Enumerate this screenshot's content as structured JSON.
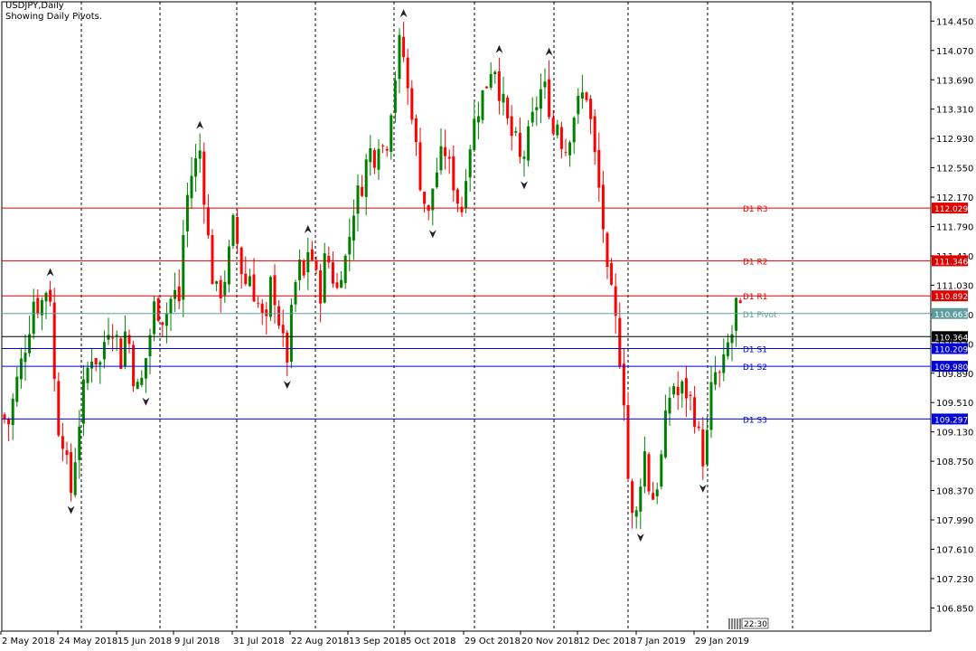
{
  "header": {
    "symbol_line": "USDJPY,Daily",
    "indicator_line": "Showing Daily Pivots."
  },
  "clock": "22:30",
  "colors": {
    "bull": "#008000",
    "bear": "#ff0000",
    "resistance": "#e00000",
    "support": "#0000dd",
    "pivot": "#5f9ea0",
    "current": "#000000"
  },
  "chart_data": {
    "type": "candlestick",
    "symbol": "USDJPY",
    "timeframe": "Daily",
    "ylim": [
      106.55,
      114.7
    ],
    "y_ticks": [
      "114.450",
      "114.070",
      "113.690",
      "113.310",
      "112.930",
      "112.550",
      "112.170",
      "111.790",
      "111.410",
      "111.030",
      "110.650",
      "110.270",
      "109.890",
      "109.510",
      "109.130",
      "108.750",
      "108.370",
      "107.990",
      "107.610",
      "107.230",
      "106.850"
    ],
    "x_labels": [
      "2 May 2018",
      "24 May 2018",
      "15 Jun 2018",
      "9 Jul 2018",
      "31 Jul 2018",
      "22 Aug 2018",
      "13 Sep 2018",
      "5 Oct 2018",
      "29 Oct 2018",
      "20 Nov 2018",
      "12 Dec 2018",
      "7 Jan 2019",
      "29 Jan 2019"
    ],
    "pivot_levels": [
      {
        "name": "D1 R3",
        "value": "112.029",
        "kind": "resistance"
      },
      {
        "name": "D1 R2",
        "value": "111.346",
        "kind": "resistance"
      },
      {
        "name": "D1 R1",
        "value": "110.892",
        "kind": "resistance"
      },
      {
        "name": "D1 Pivot",
        "value": "110.663",
        "kind": "pivot"
      },
      {
        "name": "D1 S1",
        "value": "110.209",
        "kind": "support"
      },
      {
        "name": "D1 S2",
        "value": "109.980",
        "kind": "support"
      },
      {
        "name": "D1 S3",
        "value": "109.297",
        "kind": "support"
      }
    ],
    "current_price": "110.364",
    "close_path": [
      [
        0,
        109.55
      ],
      [
        8,
        109.15
      ],
      [
        17,
        109.7
      ],
      [
        25,
        110.1
      ],
      [
        33,
        110.55
      ],
      [
        38,
        110.9
      ],
      [
        44,
        110.7
      ],
      [
        50,
        111.0
      ],
      [
        56,
        110.9
      ],
      [
        62,
        109.3
      ],
      [
        70,
        109.05
      ],
      [
        78,
        108.3
      ],
      [
        83,
        108.8
      ],
      [
        90,
        109.5
      ],
      [
        96,
        109.9
      ],
      [
        103,
        110.2
      ],
      [
        110,
        109.95
      ],
      [
        116,
        110.35
      ],
      [
        122,
        110.6
      ],
      [
        128,
        110.4
      ],
      [
        134,
        110.05
      ],
      [
        140,
        110.55
      ],
      [
        147,
        109.9
      ],
      [
        154,
        109.6
      ],
      [
        160,
        110.0
      ],
      [
        166,
        110.4
      ],
      [
        172,
        110.85
      ],
      [
        178,
        110.6
      ],
      [
        185,
        110.7
      ],
      [
        192,
        110.95
      ],
      [
        198,
        110.8
      ],
      [
        204,
        111.9
      ],
      [
        210,
        112.4
      ],
      [
        216,
        112.6
      ],
      [
        222,
        112.8
      ],
      [
        228,
        111.9
      ],
      [
        234,
        111.2
      ],
      [
        240,
        110.9
      ],
      [
        246,
        111.0
      ],
      [
        252,
        111.3
      ],
      [
        258,
        111.8
      ],
      [
        264,
        111.5
      ],
      [
        270,
        111.0
      ],
      [
        276,
        111.2
      ],
      [
        282,
        110.9
      ],
      [
        288,
        110.7
      ],
      [
        294,
        110.4
      ],
      [
        300,
        111.1
      ],
      [
        306,
        110.8
      ],
      [
        312,
        110.3
      ],
      [
        318,
        110.1
      ],
      [
        324,
        110.8
      ],
      [
        330,
        111.3
      ],
      [
        336,
        111.1
      ],
      [
        342,
        111.6
      ],
      [
        348,
        111.2
      ],
      [
        354,
        110.9
      ],
      [
        360,
        111.4
      ],
      [
        366,
        111.3
      ],
      [
        372,
        110.9
      ],
      [
        378,
        111.3
      ],
      [
        384,
        111.4
      ],
      [
        390,
        112.0
      ],
      [
        396,
        112.2
      ],
      [
        402,
        112.4
      ],
      [
        408,
        112.8
      ],
      [
        414,
        112.7
      ],
      [
        420,
        113.0
      ],
      [
        426,
        112.7
      ],
      [
        432,
        113.3
      ],
      [
        438,
        113.8
      ],
      [
        444,
        114.3
      ],
      [
        450,
        113.6
      ],
      [
        456,
        113.3
      ],
      [
        462,
        112.6
      ],
      [
        468,
        112.2
      ],
      [
        474,
        111.9
      ],
      [
        480,
        112.4
      ],
      [
        486,
        112.6
      ],
      [
        492,
        112.8
      ],
      [
        498,
        112.5
      ],
      [
        504,
        112.3
      ],
      [
        510,
        111.9
      ],
      [
        516,
        112.6
      ],
      [
        522,
        113.0
      ],
      [
        528,
        113.3
      ],
      [
        534,
        113.5
      ],
      [
        540,
        113.7
      ],
      [
        546,
        114.0
      ],
      [
        552,
        113.6
      ],
      [
        558,
        113.3
      ],
      [
        564,
        113.0
      ],
      [
        570,
        112.9
      ],
      [
        576,
        112.6
      ],
      [
        582,
        112.8
      ],
      [
        588,
        113.1
      ],
      [
        594,
        113.4
      ],
      [
        600,
        113.6
      ],
      [
        606,
        113.5
      ],
      [
        612,
        113.0
      ],
      [
        618,
        113.2
      ],
      [
        624,
        112.7
      ],
      [
        630,
        113.0
      ],
      [
        636,
        113.3
      ],
      [
        642,
        113.4
      ],
      [
        648,
        113.6
      ],
      [
        654,
        113.1
      ],
      [
        660,
        112.5
      ],
      [
        666,
        112.0
      ],
      [
        672,
        111.1
      ],
      [
        678,
        110.8
      ],
      [
        684,
        110.3
      ],
      [
        690,
        109.7
      ],
      [
        696,
        108.3
      ],
      [
        702,
        107.8
      ],
      [
        708,
        108.5
      ],
      [
        714,
        108.9
      ],
      [
        720,
        108.2
      ],
      [
        726,
        108.4
      ],
      [
        732,
        108.8
      ],
      [
        738,
        109.4
      ],
      [
        744,
        109.8
      ],
      [
        750,
        109.6
      ],
      [
        756,
        109.7
      ],
      [
        762,
        109.6
      ],
      [
        768,
        109.4
      ],
      [
        774,
        109.0
      ],
      [
        780,
        108.7
      ],
      [
        786,
        109.6
      ],
      [
        792,
        109.9
      ],
      [
        798,
        109.8
      ],
      [
        804,
        110.2
      ],
      [
        810,
        110.4
      ],
      [
        816,
        110.9
      ],
      [
        822,
        110.4
      ]
    ]
  }
}
